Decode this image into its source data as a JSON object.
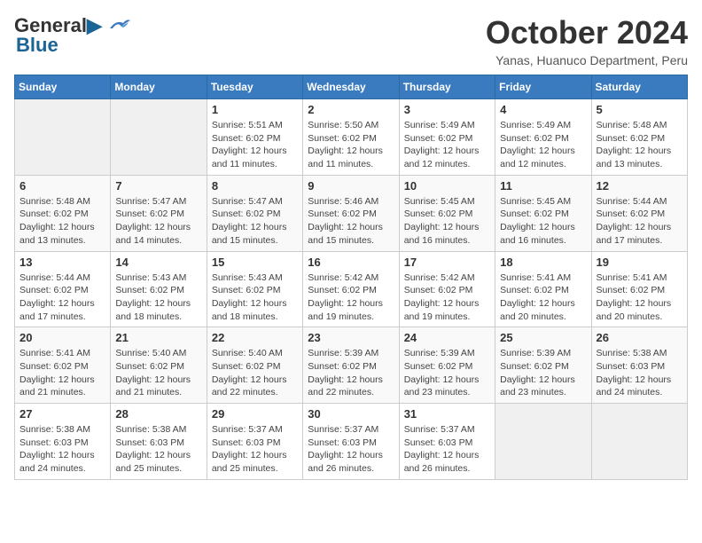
{
  "logo": {
    "line1": "General",
    "line2": "Blue"
  },
  "title": "October 2024",
  "subtitle": "Yanas, Huanuco Department, Peru",
  "weekdays": [
    "Sunday",
    "Monday",
    "Tuesday",
    "Wednesday",
    "Thursday",
    "Friday",
    "Saturday"
  ],
  "weeks": [
    [
      {
        "day": "",
        "empty": true
      },
      {
        "day": "",
        "empty": true
      },
      {
        "day": "1",
        "sunrise": "Sunrise: 5:51 AM",
        "sunset": "Sunset: 6:02 PM",
        "daylight": "Daylight: 12 hours and 11 minutes."
      },
      {
        "day": "2",
        "sunrise": "Sunrise: 5:50 AM",
        "sunset": "Sunset: 6:02 PM",
        "daylight": "Daylight: 12 hours and 11 minutes."
      },
      {
        "day": "3",
        "sunrise": "Sunrise: 5:49 AM",
        "sunset": "Sunset: 6:02 PM",
        "daylight": "Daylight: 12 hours and 12 minutes."
      },
      {
        "day": "4",
        "sunrise": "Sunrise: 5:49 AM",
        "sunset": "Sunset: 6:02 PM",
        "daylight": "Daylight: 12 hours and 12 minutes."
      },
      {
        "day": "5",
        "sunrise": "Sunrise: 5:48 AM",
        "sunset": "Sunset: 6:02 PM",
        "daylight": "Daylight: 12 hours and 13 minutes."
      }
    ],
    [
      {
        "day": "6",
        "sunrise": "Sunrise: 5:48 AM",
        "sunset": "Sunset: 6:02 PM",
        "daylight": "Daylight: 12 hours and 13 minutes."
      },
      {
        "day": "7",
        "sunrise": "Sunrise: 5:47 AM",
        "sunset": "Sunset: 6:02 PM",
        "daylight": "Daylight: 12 hours and 14 minutes."
      },
      {
        "day": "8",
        "sunrise": "Sunrise: 5:47 AM",
        "sunset": "Sunset: 6:02 PM",
        "daylight": "Daylight: 12 hours and 15 minutes."
      },
      {
        "day": "9",
        "sunrise": "Sunrise: 5:46 AM",
        "sunset": "Sunset: 6:02 PM",
        "daylight": "Daylight: 12 hours and 15 minutes."
      },
      {
        "day": "10",
        "sunrise": "Sunrise: 5:45 AM",
        "sunset": "Sunset: 6:02 PM",
        "daylight": "Daylight: 12 hours and 16 minutes."
      },
      {
        "day": "11",
        "sunrise": "Sunrise: 5:45 AM",
        "sunset": "Sunset: 6:02 PM",
        "daylight": "Daylight: 12 hours and 16 minutes."
      },
      {
        "day": "12",
        "sunrise": "Sunrise: 5:44 AM",
        "sunset": "Sunset: 6:02 PM",
        "daylight": "Daylight: 12 hours and 17 minutes."
      }
    ],
    [
      {
        "day": "13",
        "sunrise": "Sunrise: 5:44 AM",
        "sunset": "Sunset: 6:02 PM",
        "daylight": "Daylight: 12 hours and 17 minutes."
      },
      {
        "day": "14",
        "sunrise": "Sunrise: 5:43 AM",
        "sunset": "Sunset: 6:02 PM",
        "daylight": "Daylight: 12 hours and 18 minutes."
      },
      {
        "day": "15",
        "sunrise": "Sunrise: 5:43 AM",
        "sunset": "Sunset: 6:02 PM",
        "daylight": "Daylight: 12 hours and 18 minutes."
      },
      {
        "day": "16",
        "sunrise": "Sunrise: 5:42 AM",
        "sunset": "Sunset: 6:02 PM",
        "daylight": "Daylight: 12 hours and 19 minutes."
      },
      {
        "day": "17",
        "sunrise": "Sunrise: 5:42 AM",
        "sunset": "Sunset: 6:02 PM",
        "daylight": "Daylight: 12 hours and 19 minutes."
      },
      {
        "day": "18",
        "sunrise": "Sunrise: 5:41 AM",
        "sunset": "Sunset: 6:02 PM",
        "daylight": "Daylight: 12 hours and 20 minutes."
      },
      {
        "day": "19",
        "sunrise": "Sunrise: 5:41 AM",
        "sunset": "Sunset: 6:02 PM",
        "daylight": "Daylight: 12 hours and 20 minutes."
      }
    ],
    [
      {
        "day": "20",
        "sunrise": "Sunrise: 5:41 AM",
        "sunset": "Sunset: 6:02 PM",
        "daylight": "Daylight: 12 hours and 21 minutes."
      },
      {
        "day": "21",
        "sunrise": "Sunrise: 5:40 AM",
        "sunset": "Sunset: 6:02 PM",
        "daylight": "Daylight: 12 hours and 21 minutes."
      },
      {
        "day": "22",
        "sunrise": "Sunrise: 5:40 AM",
        "sunset": "Sunset: 6:02 PM",
        "daylight": "Daylight: 12 hours and 22 minutes."
      },
      {
        "day": "23",
        "sunrise": "Sunrise: 5:39 AM",
        "sunset": "Sunset: 6:02 PM",
        "daylight": "Daylight: 12 hours and 22 minutes."
      },
      {
        "day": "24",
        "sunrise": "Sunrise: 5:39 AM",
        "sunset": "Sunset: 6:02 PM",
        "daylight": "Daylight: 12 hours and 23 minutes."
      },
      {
        "day": "25",
        "sunrise": "Sunrise: 5:39 AM",
        "sunset": "Sunset: 6:02 PM",
        "daylight": "Daylight: 12 hours and 23 minutes."
      },
      {
        "day": "26",
        "sunrise": "Sunrise: 5:38 AM",
        "sunset": "Sunset: 6:03 PM",
        "daylight": "Daylight: 12 hours and 24 minutes."
      }
    ],
    [
      {
        "day": "27",
        "sunrise": "Sunrise: 5:38 AM",
        "sunset": "Sunset: 6:03 PM",
        "daylight": "Daylight: 12 hours and 24 minutes."
      },
      {
        "day": "28",
        "sunrise": "Sunrise: 5:38 AM",
        "sunset": "Sunset: 6:03 PM",
        "daylight": "Daylight: 12 hours and 25 minutes."
      },
      {
        "day": "29",
        "sunrise": "Sunrise: 5:37 AM",
        "sunset": "Sunset: 6:03 PM",
        "daylight": "Daylight: 12 hours and 25 minutes."
      },
      {
        "day": "30",
        "sunrise": "Sunrise: 5:37 AM",
        "sunset": "Sunset: 6:03 PM",
        "daylight": "Daylight: 12 hours and 26 minutes."
      },
      {
        "day": "31",
        "sunrise": "Sunrise: 5:37 AM",
        "sunset": "Sunset: 6:03 PM",
        "daylight": "Daylight: 12 hours and 26 minutes."
      },
      {
        "day": "",
        "empty": true
      },
      {
        "day": "",
        "empty": true
      }
    ]
  ]
}
